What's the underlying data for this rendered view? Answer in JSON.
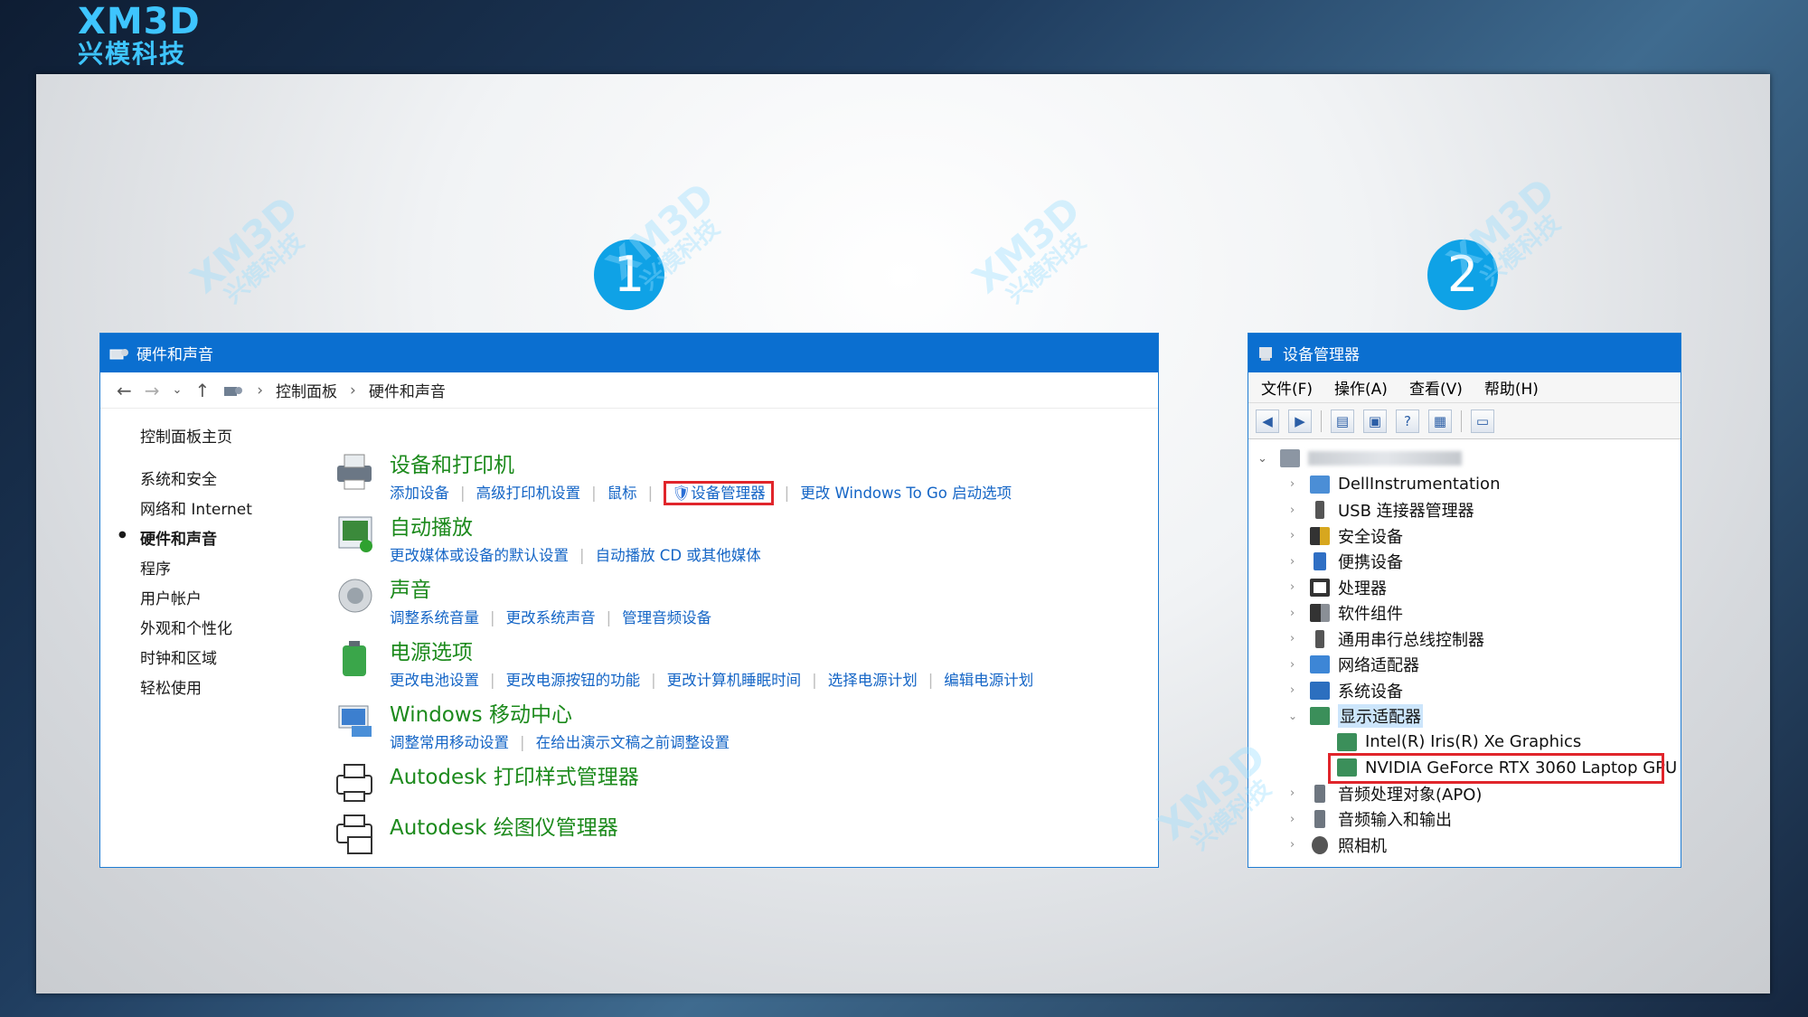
{
  "logo": {
    "line1": "XM3D",
    "line2": "兴模科技"
  },
  "watermark": {
    "line1": "XM3D",
    "line2": "兴模科技"
  },
  "steps": [
    "1",
    "2"
  ],
  "window1": {
    "title": "硬件和声音",
    "breadcrumb": [
      "控制面板",
      "硬件和声音"
    ],
    "sidebar": [
      "控制面板主页",
      "系统和安全",
      "网络和 Internet",
      "硬件和声音",
      "程序",
      "用户帐户",
      "外观和个性化",
      "时钟和区域",
      "轻松使用"
    ],
    "categories": [
      {
        "title": "设备和打印机",
        "links": [
          "添加设备",
          "高级打印机设置",
          "鼠标",
          "设备管理器",
          "更改 Windows To Go 启动选项"
        ]
      },
      {
        "title": "自动播放",
        "links": [
          "更改媒体或设备的默认设置",
          "自动播放 CD 或其他媒体"
        ]
      },
      {
        "title": "声音",
        "links": [
          "调整系统音量",
          "更改系统声音",
          "管理音频设备"
        ]
      },
      {
        "title": "电源选项",
        "links": [
          "更改电池设置",
          "更改电源按钮的功能",
          "更改计算机睡眠时间",
          "选择电源计划",
          "编辑电源计划"
        ]
      },
      {
        "title": "Windows 移动中心",
        "links": [
          "调整常用移动设置",
          "在给出演示文稿之前调整设置"
        ]
      },
      {
        "title": "Autodesk 打印样式管理器",
        "links": []
      },
      {
        "title": "Autodesk 绘图仪管理器",
        "links": []
      }
    ]
  },
  "window2": {
    "title": "设备管理器",
    "menu": [
      "文件(F)",
      "操作(A)",
      "查看(V)",
      "帮助(H)"
    ],
    "tree": [
      "DellInstrumentation",
      "USB 连接器管理器",
      "安全设备",
      "便携设备",
      "处理器",
      "软件组件",
      "通用串行总线控制器",
      "网络适配器",
      "系统设备",
      "显示适配器",
      "Intel(R) Iris(R) Xe Graphics",
      "NVIDIA GeForce RTX 3060 Laptop GPU",
      "音频处理对象(APO)",
      "音频输入和输出",
      "照相机"
    ]
  }
}
